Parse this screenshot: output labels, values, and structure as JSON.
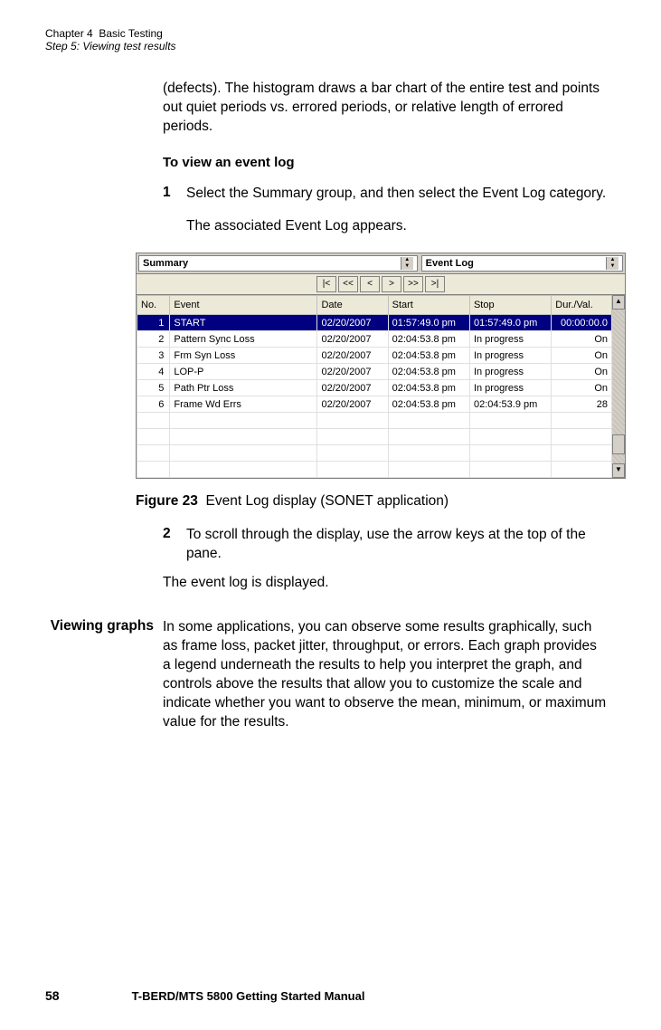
{
  "header": {
    "chapter_label": "Chapter 4",
    "chapter_title": "Basic Testing",
    "step_line": "Step 5: Viewing test results"
  },
  "intro_para": "(defects). The histogram draws a bar chart of the entire test and points out quiet periods vs. errored periods, or relative length of errored periods.",
  "procedure": {
    "heading": "To view an event log",
    "step1_num": "1",
    "step1_text": "Select the Summary group, and then select the Event Log category.",
    "step1_result": "The associated Event Log appears.",
    "step2_num": "2",
    "step2_text": "To scroll through the display, use the arrow keys at the top of the pane.",
    "closing": "The event log is displayed."
  },
  "figure": {
    "label": "Figure 23",
    "caption": "Event Log display (SONET application)"
  },
  "eventlog": {
    "group": "Summary",
    "category": "Event Log",
    "nav": {
      "first": "|<",
      "prev_page": "<<",
      "prev": "<",
      "next": ">",
      "next_page": ">>",
      "last": ">|"
    },
    "columns": {
      "no": "No.",
      "event": "Event",
      "date": "Date",
      "start": "Start",
      "stop": "Stop",
      "dur": "Dur./Val."
    },
    "rows": [
      {
        "no": "1",
        "event": "START",
        "date": "02/20/2007",
        "start": "01:57:49.0 pm",
        "stop": "01:57:49.0 pm",
        "dur": "00:00:00.0",
        "sel": true
      },
      {
        "no": "2",
        "event": "Pattern Sync Loss",
        "date": "02/20/2007",
        "start": "02:04:53.8 pm",
        "stop": "In progress",
        "dur": "On"
      },
      {
        "no": "3",
        "event": "Frm Syn Loss",
        "date": "02/20/2007",
        "start": "02:04:53.8 pm",
        "stop": "In progress",
        "dur": "On"
      },
      {
        "no": "4",
        "event": "LOP-P",
        "date": "02/20/2007",
        "start": "02:04:53.8 pm",
        "stop": "In progress",
        "dur": "On"
      },
      {
        "no": "5",
        "event": "Path Ptr Loss",
        "date": "02/20/2007",
        "start": "02:04:53.8 pm",
        "stop": "In progress",
        "dur": "On"
      },
      {
        "no": "6",
        "event": "Frame Wd Errs",
        "date": "02/20/2007",
        "start": "02:04:53.8 pm",
        "stop": "02:04:53.9 pm",
        "dur": "28"
      }
    ]
  },
  "viewing_graphs": {
    "heading": "Viewing graphs",
    "body": "In some applications, you can observe some results graphically, such as frame loss, packet jitter, throughput, or errors. Each graph provides a legend underneath the results to help you interpret the graph, and controls above the results that allow you to customize the scale and indicate whether you want to observe the mean, minimum, or maximum value for the results."
  },
  "footer": {
    "page": "58",
    "title": "T-BERD/MTS 5800 Getting Started Manual"
  }
}
